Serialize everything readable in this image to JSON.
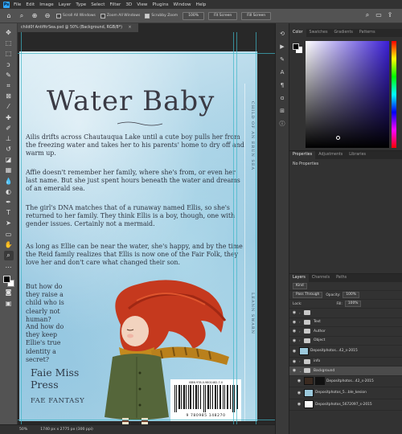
{
  "menubar": {
    "logo": "Ps",
    "items": [
      "File",
      "Edit",
      "Image",
      "Layer",
      "Type",
      "Select",
      "Filter",
      "3D",
      "View",
      "Plugins",
      "Window",
      "Help"
    ]
  },
  "options": {
    "scroll_all_label": "Scroll All Windows",
    "fit_label": "100%",
    "fit_screen_label": "Fit Screen",
    "fill_screen_label": "Fill Screen",
    "zoom_all_label": "Zoom All Windows",
    "scrubby_label": "Scrubby Zoom"
  },
  "tab": {
    "title": "child0f AntifitrSea.psd @ 50% (Background, RGB/8*)",
    "close": "×"
  },
  "cover": {
    "title": "Water Baby",
    "paragraphs": [
      "Ailis drifts across Chautauqua Lake until a cute boy pulls her from the freezing water and takes her to his parents' home to dry off and warm up.",
      "Affie doesn't remember her family, where she's from, or even her last name. But she just spent hours beneath the water and dreams of an emerald sea.",
      "The girl's DNA matches that of a runaway named Ellis, so she's returned to her family. They think Ellis is a boy, though, one with gender issues. Certainly not a mermaid.",
      "As long as Ellie can be near the water, she's happy, and by the time the Reid family realizes that Ellis is now one of the Fair Folk, they love her and don't care what changed their son."
    ],
    "short_paras": [
      "But how do they raise a child who is clearly not human?",
      "And how do they keep Ellie's true identity a secret?"
    ],
    "spine_title": "CHILD OF AN ERUN SEA",
    "spine_author": "LEANN SWARN",
    "publisher_line1": "Faie Miss",
    "publisher_line2": "Press",
    "genre": "FAE FANTASY",
    "barcode_isbn": "ISBN 978-0-9801482-7-0",
    "barcode_digits": "9 780985 148270"
  },
  "status": {
    "zoom": "50%",
    "doc_size": "1740 px x 2775 px (300 ppi)"
  },
  "panels": {
    "color_tabs": [
      "Color",
      "Swatches",
      "Gradients",
      "Patterns"
    ],
    "props_tabs": [
      "Properties",
      "Adjustments",
      "Libraries"
    ],
    "no_properties": "No Properties",
    "layers_tabs": [
      "Layers",
      "Channels",
      "Paths"
    ],
    "kind_label": "Kind",
    "blend_mode": "Pass Through",
    "opacity_label": "Opacity:",
    "opacity_value": "100%",
    "lock_label": "Lock:",
    "fill_label": "Fill:",
    "fill_value": "100%",
    "layers": [
      {
        "name": "",
        "type": "folder",
        "indent": 0
      },
      {
        "name": "Text",
        "type": "folder",
        "indent": 0
      },
      {
        "name": "Author",
        "type": "folder",
        "indent": 0
      },
      {
        "name": "Object",
        "type": "folder",
        "indent": 0
      },
      {
        "name": "Depositphotos...42_s-2015",
        "type": "image",
        "indent": 0
      },
      {
        "name": "info",
        "type": "folder",
        "indent": 0
      },
      {
        "name": "Background",
        "type": "folder",
        "indent": 0,
        "selected": true
      },
      {
        "name": "Depositphotos...42_s-2015",
        "type": "image2",
        "indent": 1
      },
      {
        "name": "Depositphotos_5...ble_kesion",
        "type": "image3",
        "indent": 1
      },
      {
        "name": "Depositphotos_5672097_s-2015",
        "type": "image4",
        "indent": 1
      }
    ]
  },
  "colors": {
    "accent": "#31a8ff",
    "guide": "#3fb6c8"
  }
}
